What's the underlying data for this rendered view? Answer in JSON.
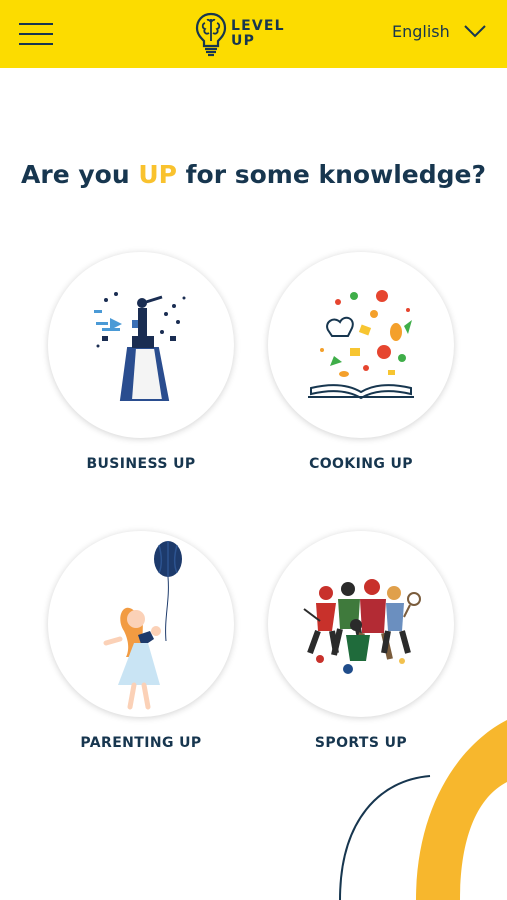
{
  "header": {
    "logo_line1": "LEVEL",
    "logo_line2": "UP",
    "language": "English"
  },
  "headline": {
    "prefix": "Are you ",
    "accent": "UP",
    "suffix": " for some knowledge?"
  },
  "categories": [
    {
      "label": "BUSINESS UP"
    },
    {
      "label": "COOKING UP"
    },
    {
      "label": "PARENTING UP"
    },
    {
      "label": "SPORTS UP"
    }
  ],
  "colors": {
    "header_bg": "#fcdc00",
    "navy": "#17364f",
    "accent_yellow": "#f9c22e",
    "arc_orange": "#f7b72d"
  },
  "icons": {
    "menu": "hamburger-menu-icon",
    "logo": "brain-lightbulb-icon",
    "language_toggle": "chevron-down-icon"
  }
}
